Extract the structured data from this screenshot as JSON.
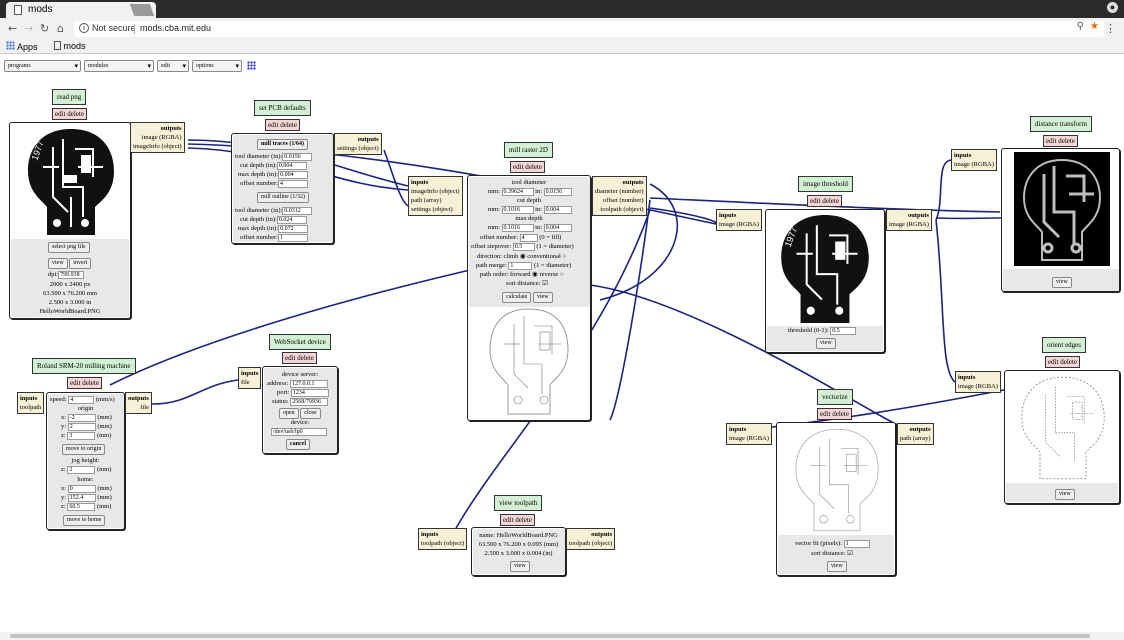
{
  "browser": {
    "tab_title": "mods",
    "url_security": "Not secure",
    "url": "mods.cba.mit.edu",
    "bookmarks": [
      "Apps",
      "mods"
    ],
    "icons": [
      "back-icon",
      "forward-icon",
      "reload-icon",
      "home-icon",
      "info-icon",
      "zoom-icon",
      "star-icon",
      "menu-icon"
    ]
  },
  "toolbar": {
    "programs": "programs",
    "modules": "modules",
    "edit": "edit",
    "options": "options"
  },
  "read_png": {
    "title": "read png",
    "edit": "edit delete",
    "out_label": "outputs",
    "out1": "image (RGBA)",
    "out2": "imageInfo (object)",
    "select": "select png file",
    "view": "view",
    "invert": "invert",
    "dpi_label": "dpi:",
    "dpi": "799.938",
    "px": "2000 x 2400 px",
    "mm": "63.500 x 76.200 mm",
    "in": "2.500 x 3.000 in",
    "file": "HelloWorldBoard.PNG"
  },
  "pcb": {
    "title": "set PCB defaults",
    "edit": "edit delete",
    "out_label": "outputs",
    "out1": "settings (object)",
    "mill1": "mill traces (1/64)",
    "mill2": "mill outline (1/32)",
    "labels": [
      "tool diameter (in):",
      "cut depth (in):",
      "max depth (in):",
      "offset number:"
    ],
    "v1": [
      "0.0156",
      "0.004",
      "0.004",
      "4"
    ],
    "v2": [
      "0.0312",
      "0.024",
      "0.072",
      "1"
    ]
  },
  "mill": {
    "title": "mill raster 2D",
    "edit": "edit delete",
    "in_label": "inputs",
    "in1": "imageInfo (object)",
    "in2": "path (array)",
    "in3": "settings (object)",
    "out_label": "outputs",
    "out1": "diameter (number)",
    "out2": "offset (number)",
    "out3": "toolpath (object)",
    "tool_diameter": "tool diameter",
    "td_mm": "0.39624",
    "td_in": "0.0156",
    "cut_depth": "cut depth",
    "cd_mm": "0.1016",
    "cd_in": "0.004",
    "max_depth": "max depth",
    "md_mm": "0.1016",
    "md_in": "0.004",
    "offset_number": "offset number:",
    "on": "4",
    "on_note": "(0 = fill)",
    "stepover": "offset stepover:",
    "so": "0.5",
    "so_note": "(1 = diameter)",
    "direction": "direction: climb",
    "conventional": "conventional",
    "merge": "path merge:",
    "merge_v": "1",
    "merge_note": "(1 = diameter)",
    "order": "path order: forward",
    "reverse": "reverse",
    "sort": "sort distance:",
    "calculate": "calculate",
    "view": "view",
    "mm": "mm:",
    "in": "in:"
  },
  "threshold": {
    "title": "image threshold",
    "edit": "edit delete",
    "in_label": "inputs",
    "in1": "image (RGBA)",
    "out_label": "outputs",
    "out1": "image (RGBA)",
    "th_label": "threshold (0-1):",
    "th": "0.5",
    "view": "view"
  },
  "dist": {
    "title": "distance transform",
    "edit": "edit delete",
    "in_label": "inputs",
    "in1": "image (RGBA)",
    "view": "view"
  },
  "roland": {
    "title": "Roland SRM-20 milling machine",
    "edit": "edit delete",
    "in_label": "inputs",
    "in1": "toolpath",
    "out_label": "outputs",
    "out1": "file",
    "speed": "speed:",
    "speed_v": "4",
    "speed_u": "(mm/s)",
    "origin": "origin",
    "x": "x:",
    "y": "y:",
    "z": "z:",
    "ox": "-2",
    "oy": "2",
    "oz": "3",
    "mm": "(mm)",
    "move_origin": "move to origin",
    "jog": "jog height:",
    "jz": "2",
    "home": "home:",
    "hx": "0",
    "hy": "152.4",
    "hz": "60.5",
    "move_home": "move to home"
  },
  "ws": {
    "title": "WebSocket device",
    "edit": "edit delete",
    "in_label": "inputs",
    "in1": "file",
    "ds": "device server:",
    "address": "address:",
    "address_v": "127.0.0.1",
    "port": "port:",
    "port_v": "1234",
    "status": "status:",
    "status_v": "2568/79936",
    "open": "open",
    "close": "close",
    "device": "device:",
    "device_v": "/dev/usb/lp0",
    "cancel": "cancel"
  },
  "viewtp": {
    "title": "view toolpath",
    "edit": "edit delete",
    "in_label": "inputs",
    "in1": "toolpath (object)",
    "out_label": "outputs",
    "out1": "toolpath (object)",
    "name": "name: HelloWorldBoard.PNG",
    "dims1": "63.500 x 76.200 x 0.095 (mm)",
    "dims2": "2.500 x 3.000 x 0.004 (in)",
    "view": "view"
  },
  "vect": {
    "title": "vectorize",
    "edit": "edit delete",
    "in_label": "inputs",
    "in1": "image (RGBA)",
    "out_label": "outputs",
    "out1": "path (array)",
    "fit": "vector fit (pixels):",
    "fit_v": "1",
    "sort": "sort distance:",
    "view": "view"
  },
  "orient": {
    "title": "orient edges",
    "edit": "edit delete",
    "in_label": "inputs",
    "in1": "image (RGBA)",
    "view": "view"
  },
  "pcb_year": "1977"
}
